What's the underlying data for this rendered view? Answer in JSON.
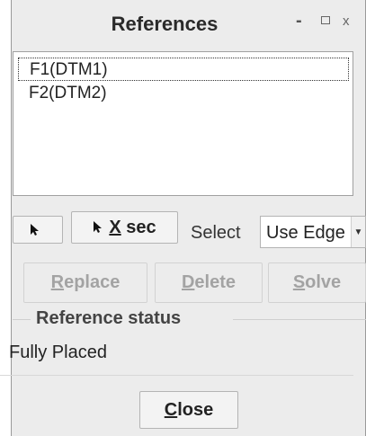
{
  "dialog": {
    "title": "References",
    "controls": {
      "minimize": "-",
      "close": "x"
    }
  },
  "references": {
    "items": [
      "F1(DTM1)",
      "F2(DTM2)"
    ],
    "selected_index": 0
  },
  "toolbar": {
    "xsec_label_mnemonic": "X",
    "xsec_label_rest": " sec",
    "select_label": "Select",
    "select_value": "Use Edge"
  },
  "actions": {
    "replace": {
      "mnemonic": "R",
      "rest": "eplace",
      "enabled": false
    },
    "delete": {
      "mnemonic": "D",
      "rest": "elete",
      "enabled": false
    },
    "solve": {
      "mnemonic": "S",
      "rest": "olve",
      "enabled": false
    }
  },
  "status": {
    "heading": "Reference status",
    "value": "Fully Placed"
  },
  "footer": {
    "close_mnemonic": "C",
    "close_rest": "lose"
  }
}
